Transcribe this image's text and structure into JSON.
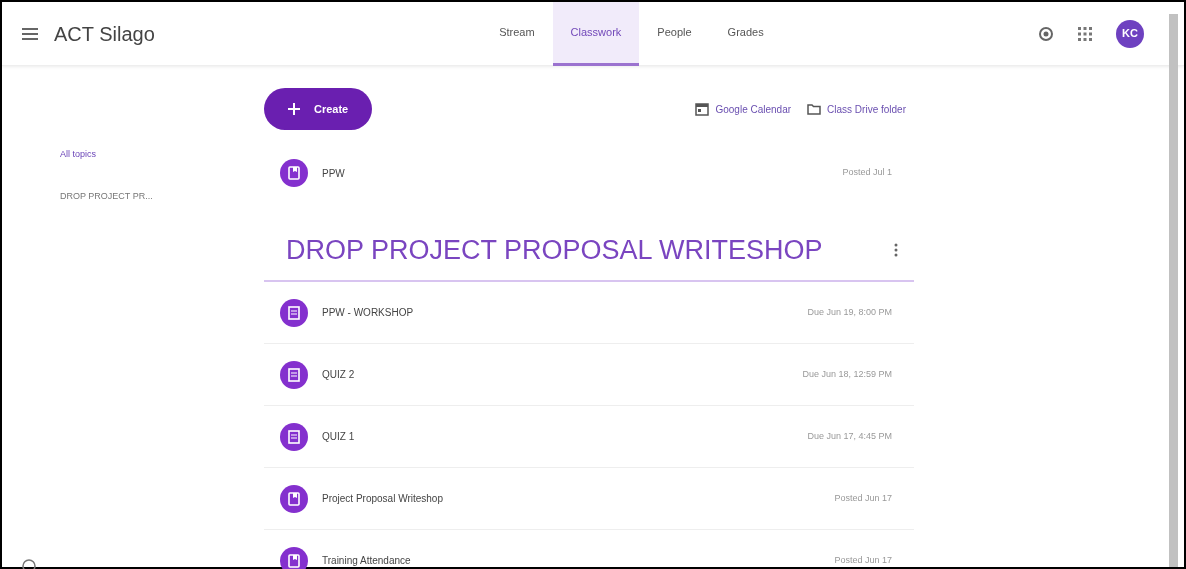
{
  "header": {
    "class_name": "ACT Silago",
    "tabs": [
      {
        "label": "Stream",
        "selected": false
      },
      {
        "label": "Classwork",
        "selected": true
      },
      {
        "label": "People",
        "selected": false
      },
      {
        "label": "Grades",
        "selected": false
      }
    ],
    "avatar": "KC"
  },
  "toolbar": {
    "create": "Create",
    "links": [
      {
        "kind": "calendar",
        "label": "Google Calendar"
      },
      {
        "kind": "folder",
        "label": "Class Drive folder"
      }
    ]
  },
  "sidebar": {
    "items": [
      {
        "label": "All topics",
        "selected": true
      },
      {
        "label": "DROP PROJECT PR...",
        "selected": false
      }
    ]
  },
  "unsorted": [
    {
      "kind": "material",
      "title": "PPW",
      "meta": "Posted Jul 1"
    }
  ],
  "topics": [
    {
      "title": "DROP PROJECT PROPOSAL WRITESHOP",
      "items": [
        {
          "kind": "assignment",
          "title": "PPW - WORKSHOP",
          "meta": "Due Jun 19, 8:00 PM"
        },
        {
          "kind": "assignment",
          "title": "QUIZ 2",
          "meta": "Due Jun 18, 12:59 PM"
        },
        {
          "kind": "assignment",
          "title": "QUIZ 1",
          "meta": "Due Jun 17, 4:45 PM"
        },
        {
          "kind": "material",
          "title": "Project Proposal Writeshop",
          "meta": "Posted Jun 17"
        },
        {
          "kind": "material",
          "title": "Training Attendance",
          "meta": "Posted Jun 17"
        }
      ]
    }
  ]
}
